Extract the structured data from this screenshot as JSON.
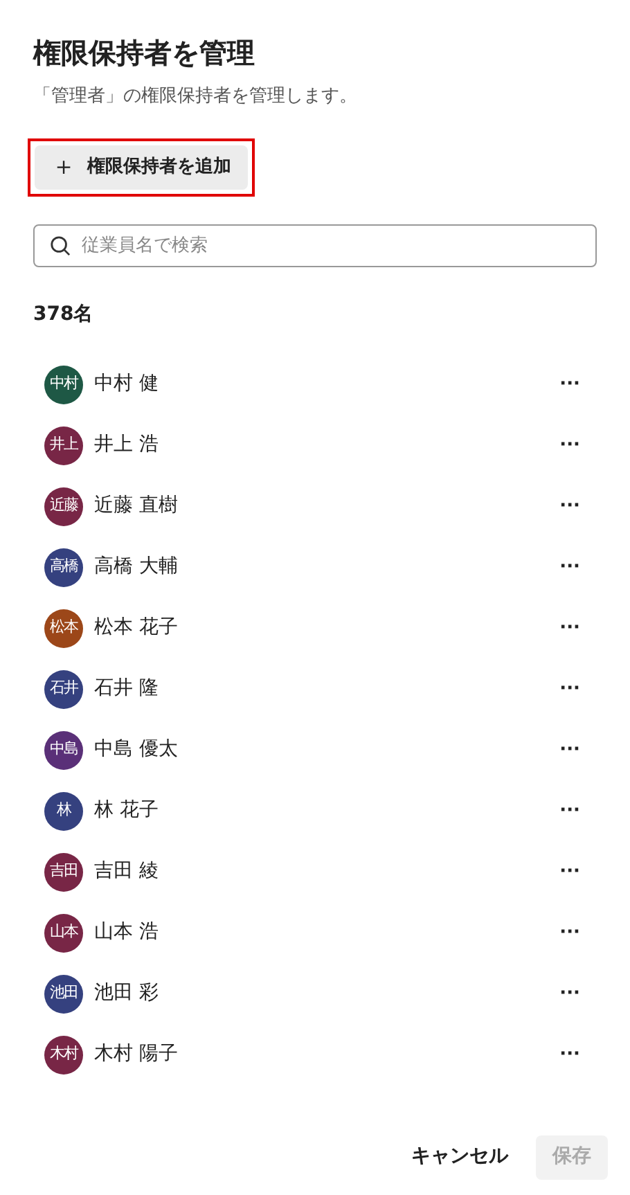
{
  "title": "権限保持者を管理",
  "subtitle": "「管理者」の権限保持者を管理します。",
  "add_button": {
    "icon": "＋",
    "label": "権限保持者を追加",
    "highlighted": true
  },
  "search": {
    "placeholder": "従業員名で検索"
  },
  "count": "378名",
  "members": [
    {
      "initials": "中村",
      "name": "中村 健",
      "color": "#1e5845",
      "menu": "···"
    },
    {
      "initials": "井上",
      "name": "井上 浩",
      "color": "#782646",
      "menu": "···"
    },
    {
      "initials": "近藤",
      "name": "近藤 直樹",
      "color": "#782646",
      "menu": "···"
    },
    {
      "initials": "高橋",
      "name": "高橋 大輔",
      "color": "#35417f",
      "menu": "···"
    },
    {
      "initials": "松本",
      "name": "松本 花子",
      "color": "#9c4719",
      "menu": "···"
    },
    {
      "initials": "石井",
      "name": "石井 隆",
      "color": "#35417f",
      "menu": "···"
    },
    {
      "initials": "中島",
      "name": "中島 優太",
      "color": "#5a3078",
      "menu": "···"
    },
    {
      "initials": "林",
      "name": "林 花子",
      "color": "#35417f",
      "menu": "···"
    },
    {
      "initials": "吉田",
      "name": "吉田 綾",
      "color": "#782646",
      "menu": "···"
    },
    {
      "initials": "山本",
      "name": "山本 浩",
      "color": "#782646",
      "menu": "···"
    },
    {
      "initials": "池田",
      "name": "池田 彩",
      "color": "#35417f",
      "menu": "···"
    },
    {
      "initials": "木村",
      "name": "木村 陽子",
      "color": "#782646",
      "menu": "···"
    }
  ],
  "footer": {
    "cancel": "キャンセル",
    "save": {
      "label": "保存",
      "disabled": true
    }
  }
}
